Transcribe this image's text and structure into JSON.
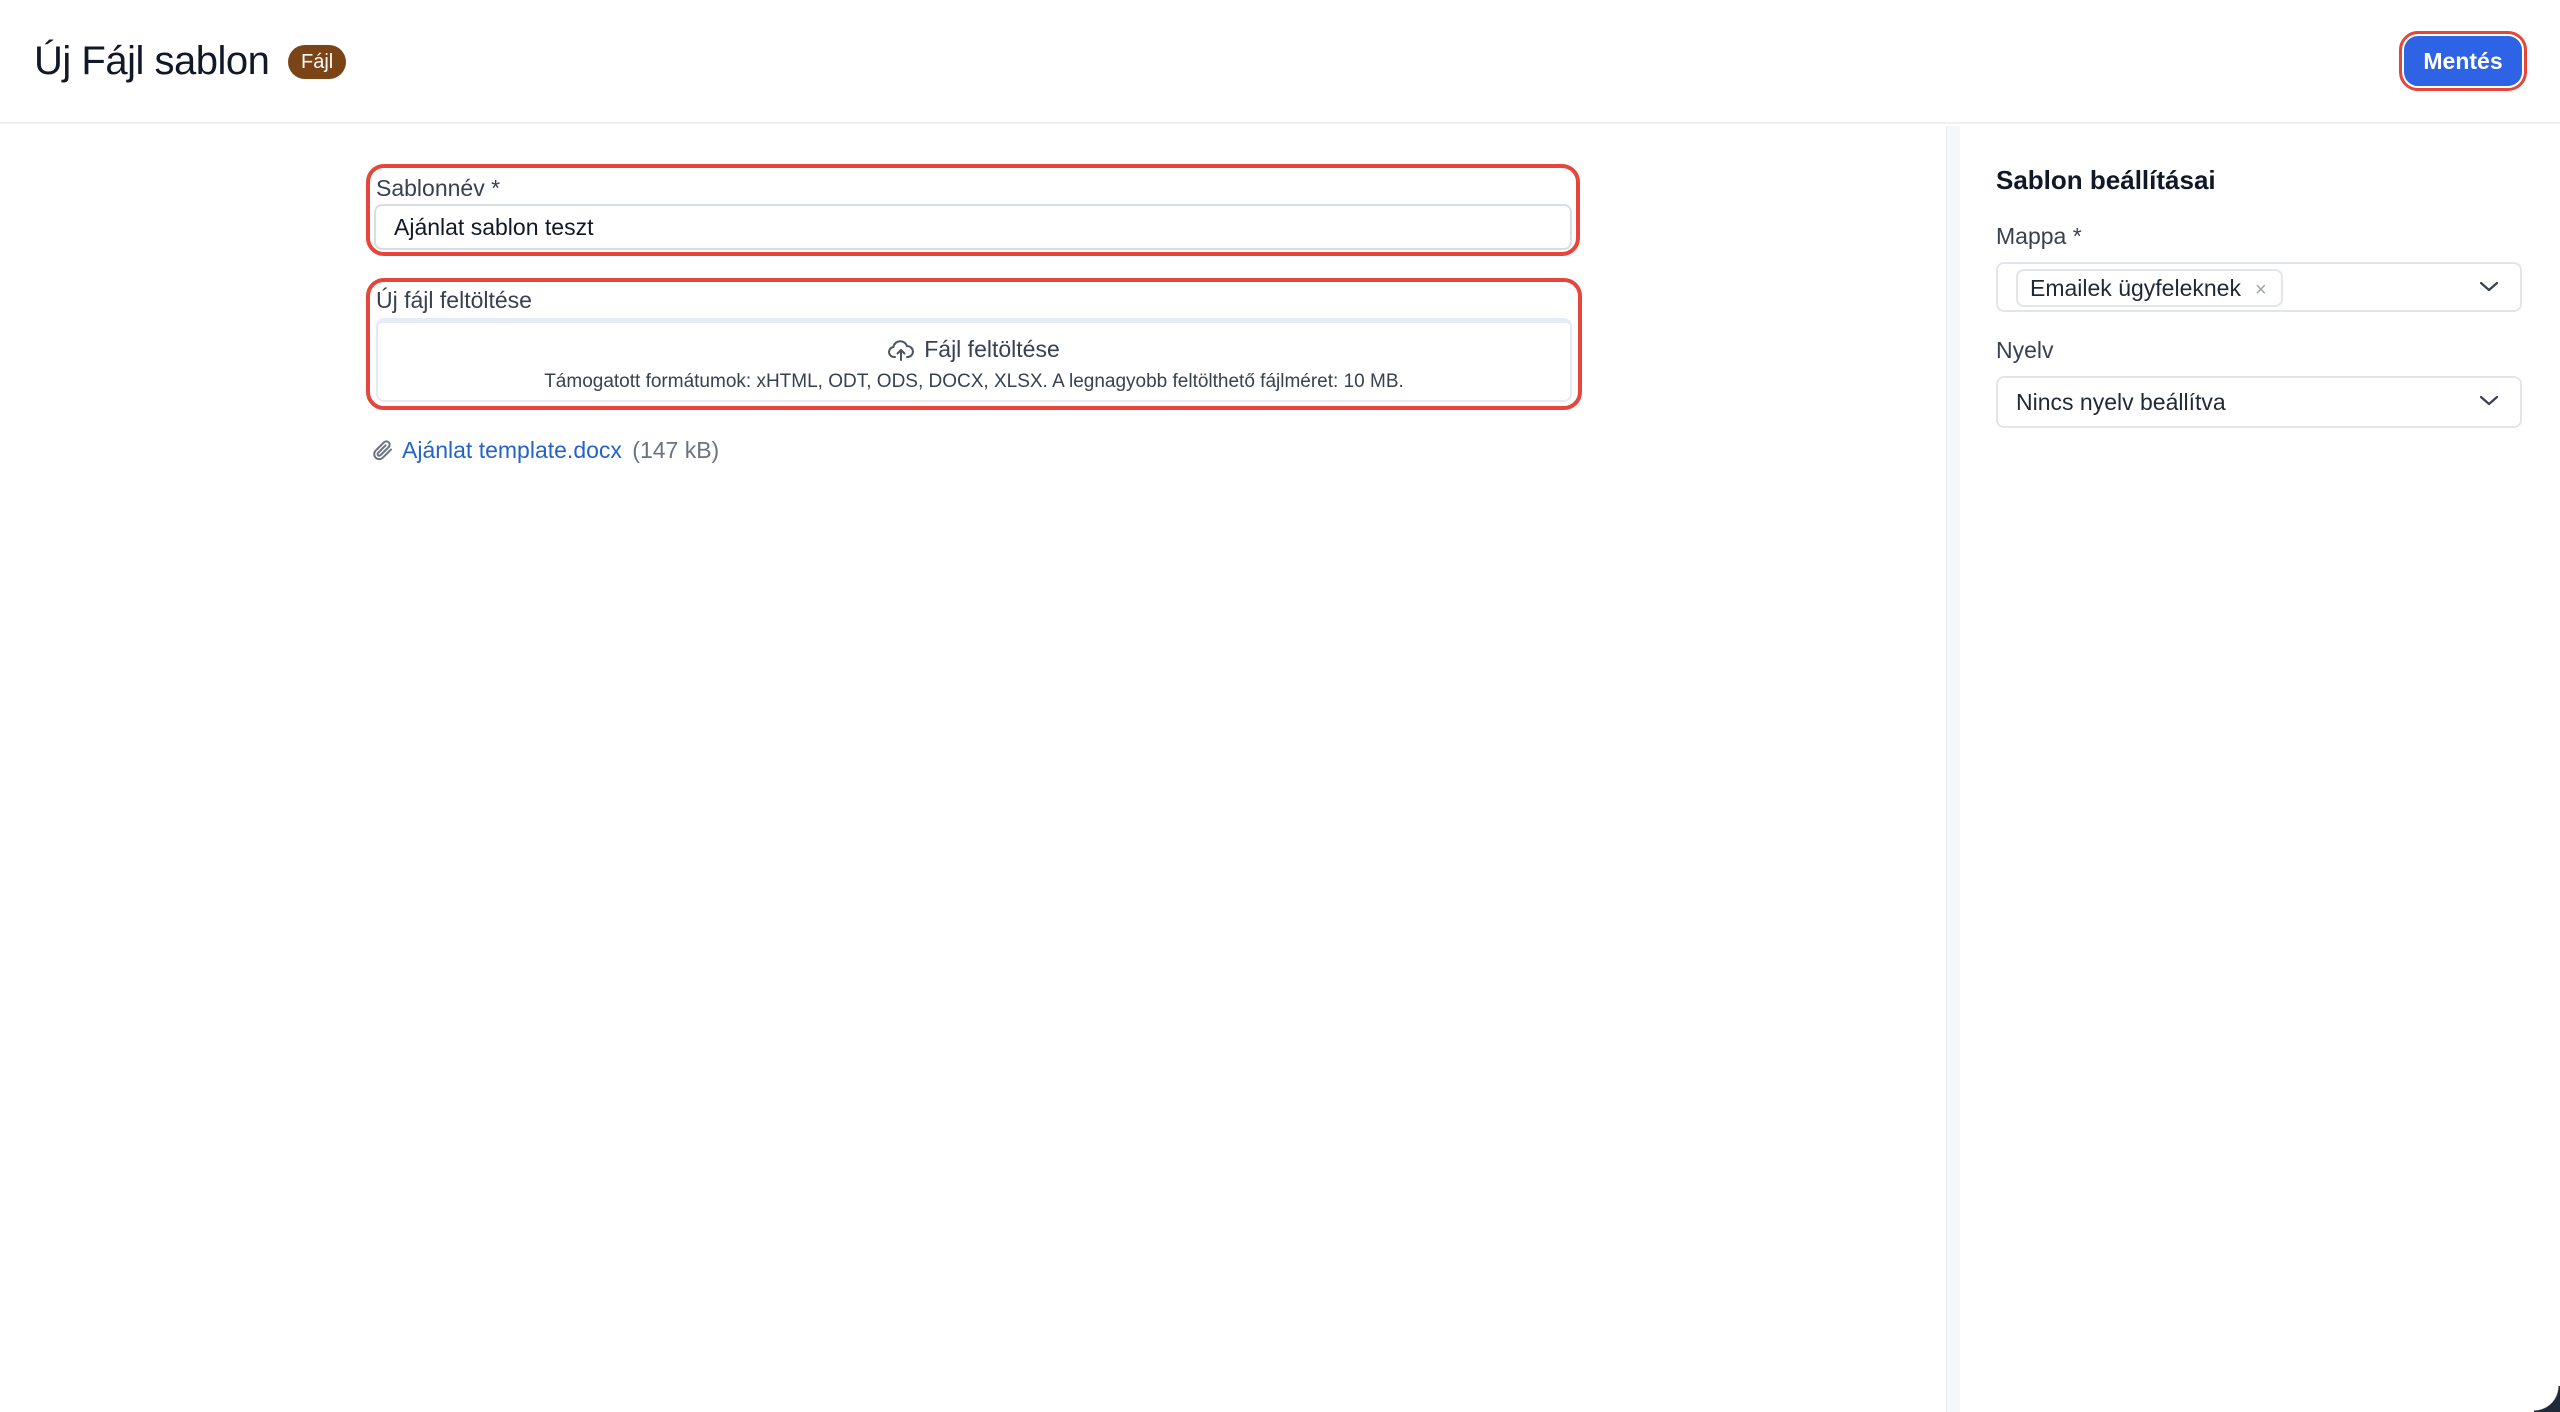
{
  "header": {
    "title": "Új Fájl sablon",
    "badge": "Fájl",
    "save_label": "Mentés"
  },
  "form": {
    "name_label": "Sablonnév *",
    "name_value": "Ajánlat sablon teszt",
    "upload_label": "Új fájl feltöltése",
    "upload_button_label": "Fájl feltöltése",
    "upload_hint": "Támogatott formátumok: xHTML, ODT, ODS, DOCX, XLSX. A legnagyobb feltölthető fájlméret: 10 MB.",
    "attachment_name": "Ajánlat template.docx",
    "attachment_size": "(147 kB)"
  },
  "sidebar": {
    "title": "Sablon beállításai",
    "folder_label": "Mappa *",
    "folder_value": "Emailek ügyfeleknek",
    "language_label": "Nyelv",
    "language_value": "Nincs nyelv beállítva"
  },
  "colors": {
    "accent": "#2f63e6",
    "badge": "#7a4417",
    "highlight": "#e5453a",
    "link": "#2563c7"
  },
  "icons": {
    "upload": "cloud-upload-icon",
    "attachment": "paperclip-icon",
    "remove": "close-icon",
    "dropdown": "chevron-down-icon"
  }
}
